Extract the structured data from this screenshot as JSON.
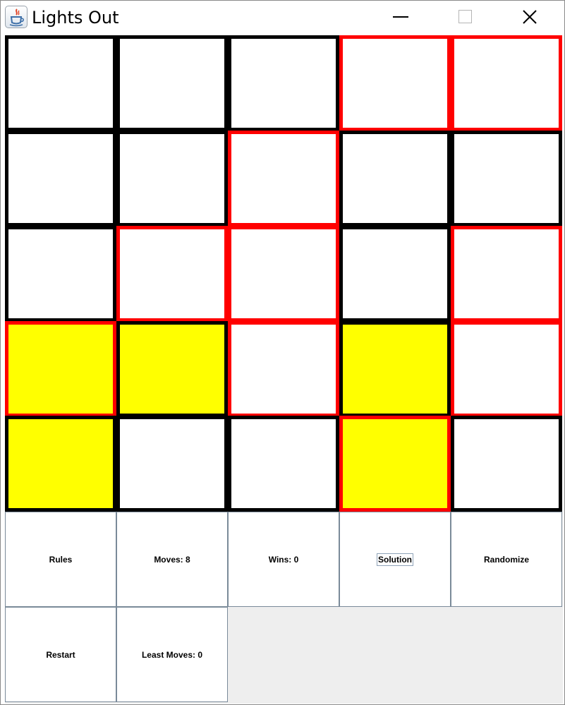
{
  "window": {
    "title": "Lights Out",
    "icon": "java-cup-icon",
    "controls": [
      "minimize-icon",
      "maximize-icon",
      "close-icon"
    ]
  },
  "board": {
    "rows": 5,
    "cols": 5,
    "colors": {
      "lit": "#ffff00",
      "unlit": "#ffffff",
      "border_default": "#000000",
      "border_highlight": "#ff0000"
    },
    "cells": [
      [
        {
          "lit": false,
          "highlight": false
        },
        {
          "lit": false,
          "highlight": false
        },
        {
          "lit": false,
          "highlight": false
        },
        {
          "lit": false,
          "highlight": true
        },
        {
          "lit": false,
          "highlight": true
        }
      ],
      [
        {
          "lit": false,
          "highlight": false
        },
        {
          "lit": false,
          "highlight": false
        },
        {
          "lit": false,
          "highlight": true
        },
        {
          "lit": false,
          "highlight": false
        },
        {
          "lit": false,
          "highlight": false
        }
      ],
      [
        {
          "lit": false,
          "highlight": false
        },
        {
          "lit": false,
          "highlight": true
        },
        {
          "lit": false,
          "highlight": true
        },
        {
          "lit": false,
          "highlight": false
        },
        {
          "lit": false,
          "highlight": true
        }
      ],
      [
        {
          "lit": true,
          "highlight": true
        },
        {
          "lit": true,
          "highlight": false
        },
        {
          "lit": false,
          "highlight": true
        },
        {
          "lit": true,
          "highlight": false
        },
        {
          "lit": false,
          "highlight": true
        }
      ],
      [
        {
          "lit": true,
          "highlight": false
        },
        {
          "lit": false,
          "highlight": false
        },
        {
          "lit": false,
          "highlight": false
        },
        {
          "lit": true,
          "highlight": true
        },
        {
          "lit": false,
          "highlight": false
        }
      ]
    ]
  },
  "controls": {
    "rules": "Rules",
    "moves": "Moves: 8",
    "wins": "Wins: 0",
    "solution": "Solution",
    "randomize": "Randomize",
    "restart": "Restart",
    "least_moves": "Least Moves: 0"
  }
}
